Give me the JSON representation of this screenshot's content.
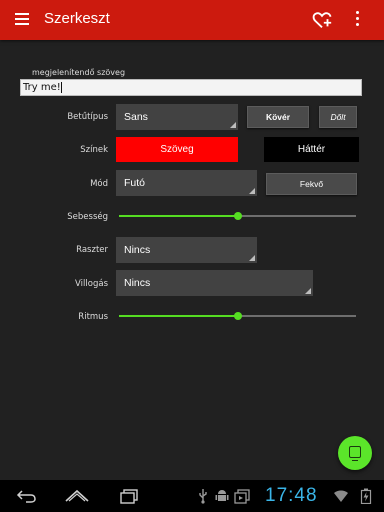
{
  "appbar": {
    "title": "Szerkeszt",
    "bg_color": "#cc1a0e",
    "icons": [
      "menu-icon",
      "heart-plus-icon",
      "more-vert-icon"
    ]
  },
  "text_field": {
    "label": "megjelenítendő szöveg",
    "value": "Try me!"
  },
  "font": {
    "label": "Betűtípus",
    "value": "Sans",
    "bold_label": "Kövér",
    "italic_label": "Dőlt"
  },
  "colors": {
    "label": "Színek",
    "text_button": "Szöveg",
    "text_button_color": "#ff0000",
    "background_button": "Háttér",
    "background_button_color": "#000000"
  },
  "mode": {
    "label": "Mód",
    "value": "Futó",
    "orientation_button": "Fekvő"
  },
  "speed": {
    "label": "Sebesség",
    "value_fraction": 0.5
  },
  "raster": {
    "label": "Raszter",
    "value": "Nincs"
  },
  "blinking": {
    "label": "Villogás",
    "value": "Nincs"
  },
  "rhythm": {
    "label": "Ritmus",
    "value_fraction": 0.5
  },
  "accent_color": "#55dd22",
  "fab": {
    "icon": "display-icon"
  },
  "status": {
    "time": "17:48",
    "icons": [
      "usb-icon",
      "android-icon",
      "media-icon",
      "wifi-icon",
      "battery-icon"
    ]
  },
  "nav": {
    "icons": [
      "back-icon",
      "home-icon",
      "recents-icon"
    ]
  }
}
